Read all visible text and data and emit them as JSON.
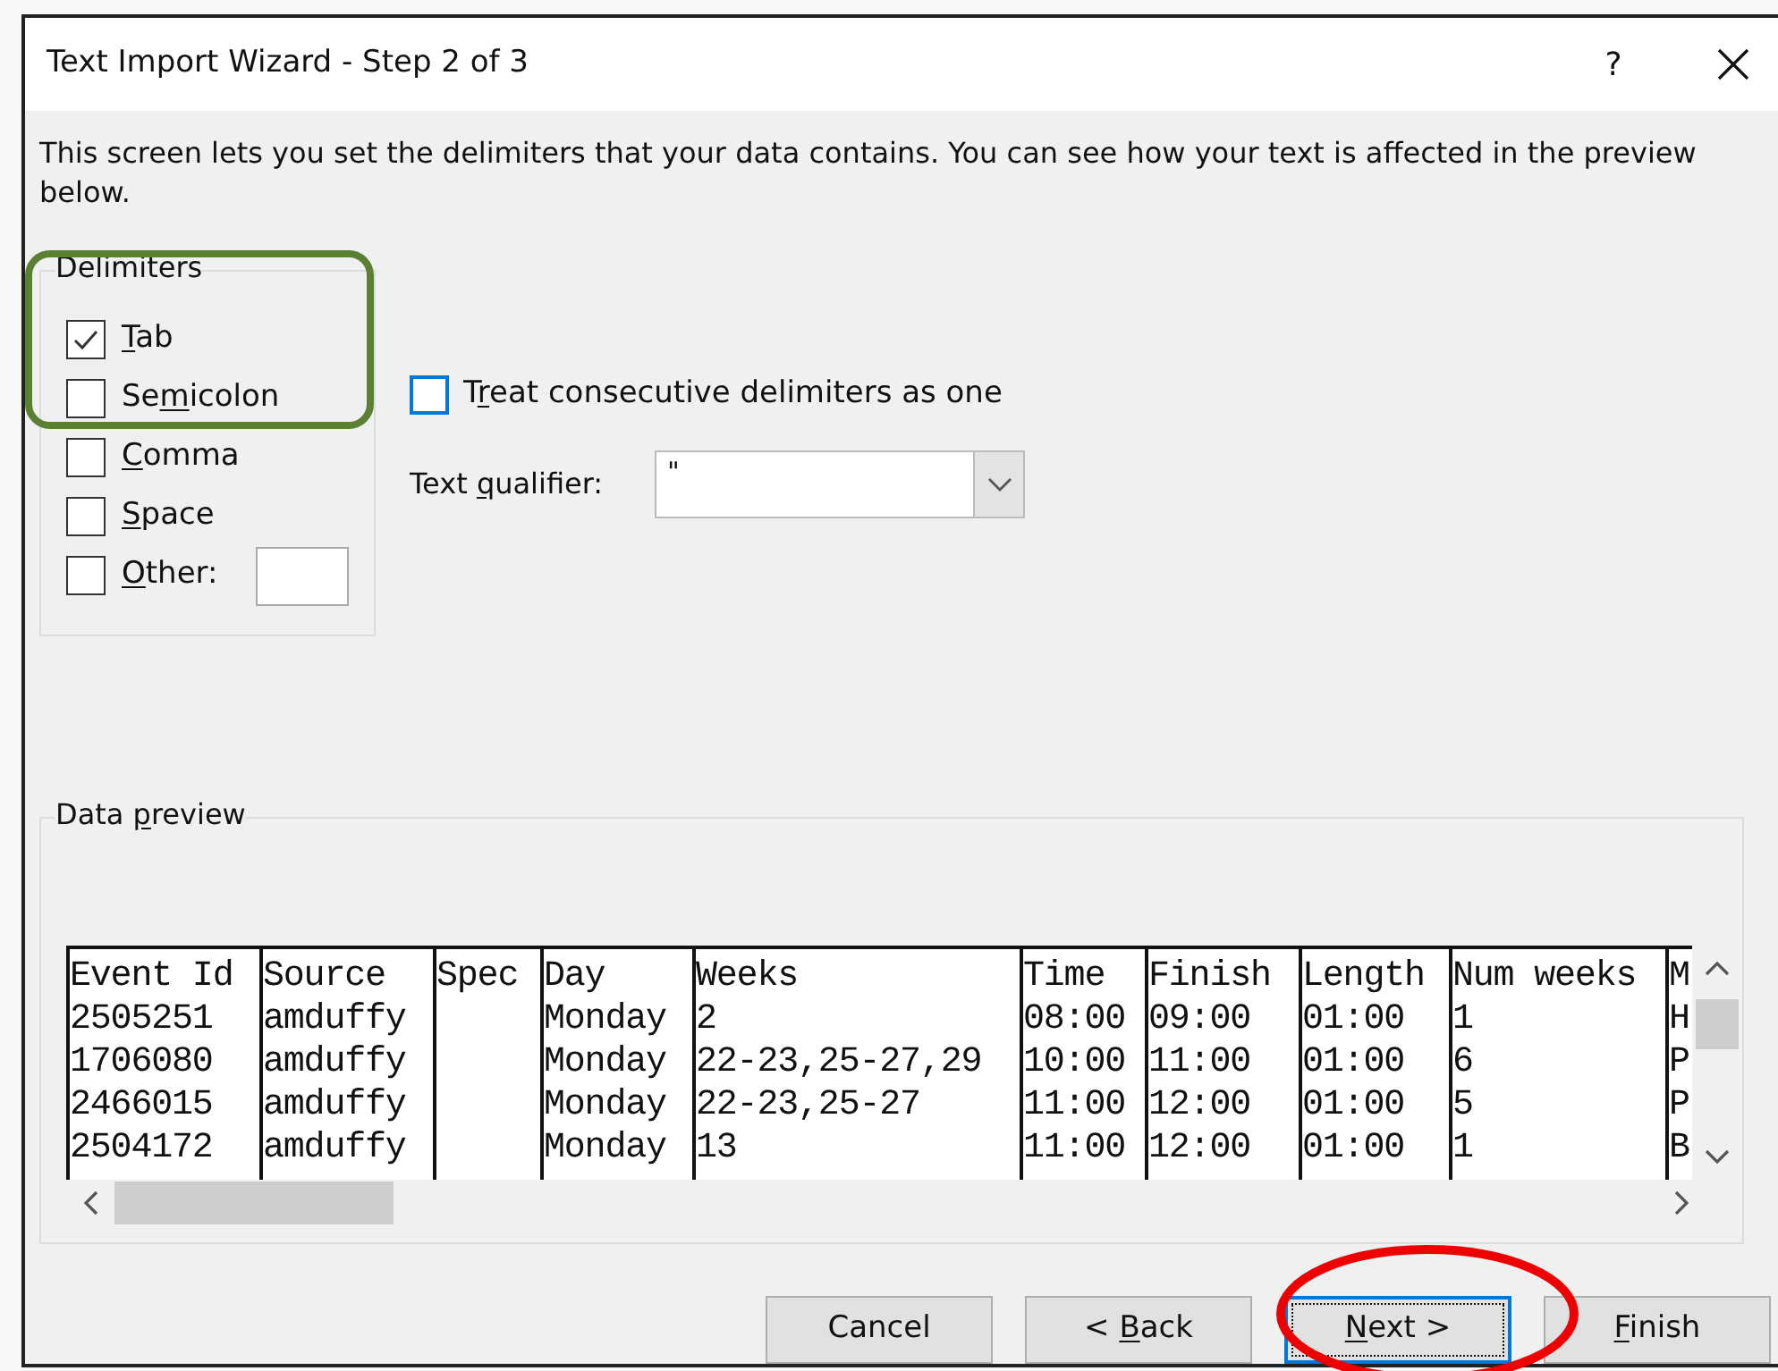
{
  "window": {
    "title": "Text Import Wizard - Step 2 of 3",
    "help": "?"
  },
  "description": "This screen lets you set the delimiters that your data contains. You can see how your text is affected in the preview below.",
  "delimiters": {
    "title": "Delimiters",
    "items": [
      {
        "label": "Tab",
        "checked": true
      },
      {
        "label": "Semicolon",
        "checked": false
      },
      {
        "label": "Comma",
        "checked": false
      },
      {
        "label": "Space",
        "checked": false
      },
      {
        "label": "Other:",
        "checked": false,
        "kind": "field"
      }
    ]
  },
  "consecutive": {
    "label": "Treat consecutive delimiters as one",
    "checked": false
  },
  "text_qualifier": {
    "label": "Text qualifier:",
    "value": "\""
  },
  "data_preview": {
    "title": "Data preview",
    "columns": [
      "Event Id",
      "Source",
      "Spec",
      "Day",
      "Weeks",
      "Time",
      "Finish",
      "Length",
      "Num weeks",
      "M"
    ],
    "rows": [
      [
        "2505251",
        "amduffy",
        "",
        "Monday",
        "2",
        "08:00",
        "09:00",
        "01:00",
        "1",
        "H"
      ],
      [
        "1706080",
        "amduffy",
        "",
        "Monday",
        "22-23,25-27,29",
        "10:00",
        "11:00",
        "01:00",
        "6",
        "P"
      ],
      [
        "2466015",
        "amduffy",
        "",
        "Monday",
        "22-23,25-27",
        "11:00",
        "12:00",
        "01:00",
        "5",
        "P"
      ],
      [
        "2504172",
        "amduffy",
        "",
        "Monday",
        "13",
        "11:00",
        "12:00",
        "01:00",
        "1",
        "B"
      ]
    ]
  },
  "buttons": [
    {
      "label": "Cancel",
      "default": false
    },
    {
      "label": "< Back",
      "default": false
    },
    {
      "label": "Next >",
      "default": true
    },
    {
      "label": "Finish",
      "default": false
    }
  ],
  "annotations": [
    {
      "kind": "rounded-rect",
      "color": "#5a8033"
    },
    {
      "kind": "ellipse",
      "color": "#ee0000"
    }
  ]
}
